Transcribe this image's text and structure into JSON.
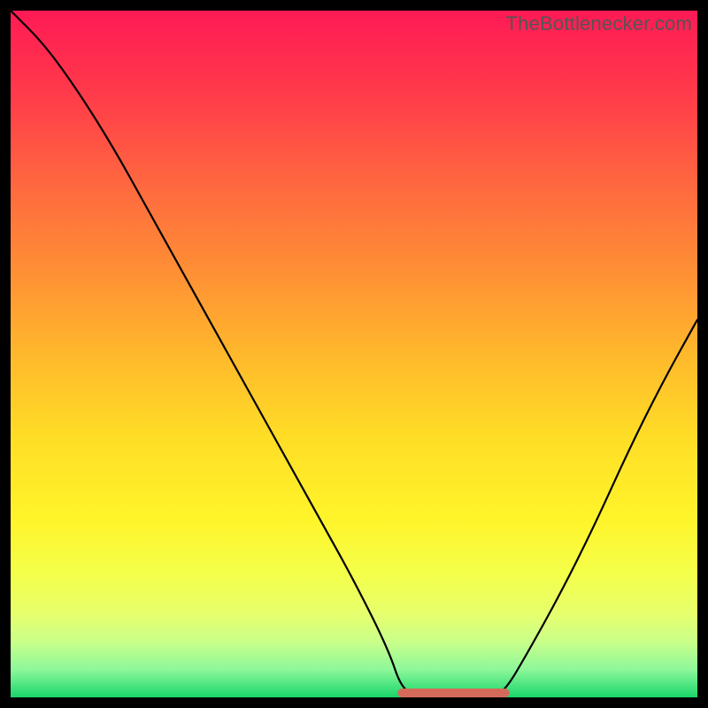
{
  "watermark": "TheBottlenecker.com",
  "colors": {
    "frame": "#000000",
    "curve": "#000000",
    "minimum_marker": "#d46a5a",
    "gradient_top": "#ff1a55",
    "gradient_bottom": "#18d66a"
  },
  "chart_data": {
    "type": "line",
    "title": "",
    "xlabel": "",
    "ylabel": "",
    "xlim": [
      0,
      100
    ],
    "ylim": [
      0,
      100
    ],
    "grid": false,
    "legend": false,
    "annotations": [
      {
        "type": "min-band",
        "x_range": [
          57,
          72
        ],
        "y": 0
      }
    ],
    "series": [
      {
        "name": "bottleneck-curve",
        "x": [
          0,
          5,
          10,
          15,
          20,
          25,
          30,
          35,
          40,
          45,
          50,
          55,
          57,
          60,
          65,
          70,
          72,
          75,
          80,
          85,
          90,
          95,
          100
        ],
        "y": [
          100,
          95,
          88,
          80,
          71,
          62,
          53,
          44,
          35,
          26,
          17,
          7,
          1,
          0,
          0,
          0,
          1,
          6,
          15,
          25,
          36,
          46,
          55
        ]
      }
    ],
    "notes": "No numeric axis ticks are rendered; values are estimated from geometry on a 0–100 normalized scale. The curve descends steeply from top-left, reaches a flat minimum roughly between x≈57 and x≈72 (highlighted by a short salmon segment), then rises toward the right edge to about 55% height."
  }
}
